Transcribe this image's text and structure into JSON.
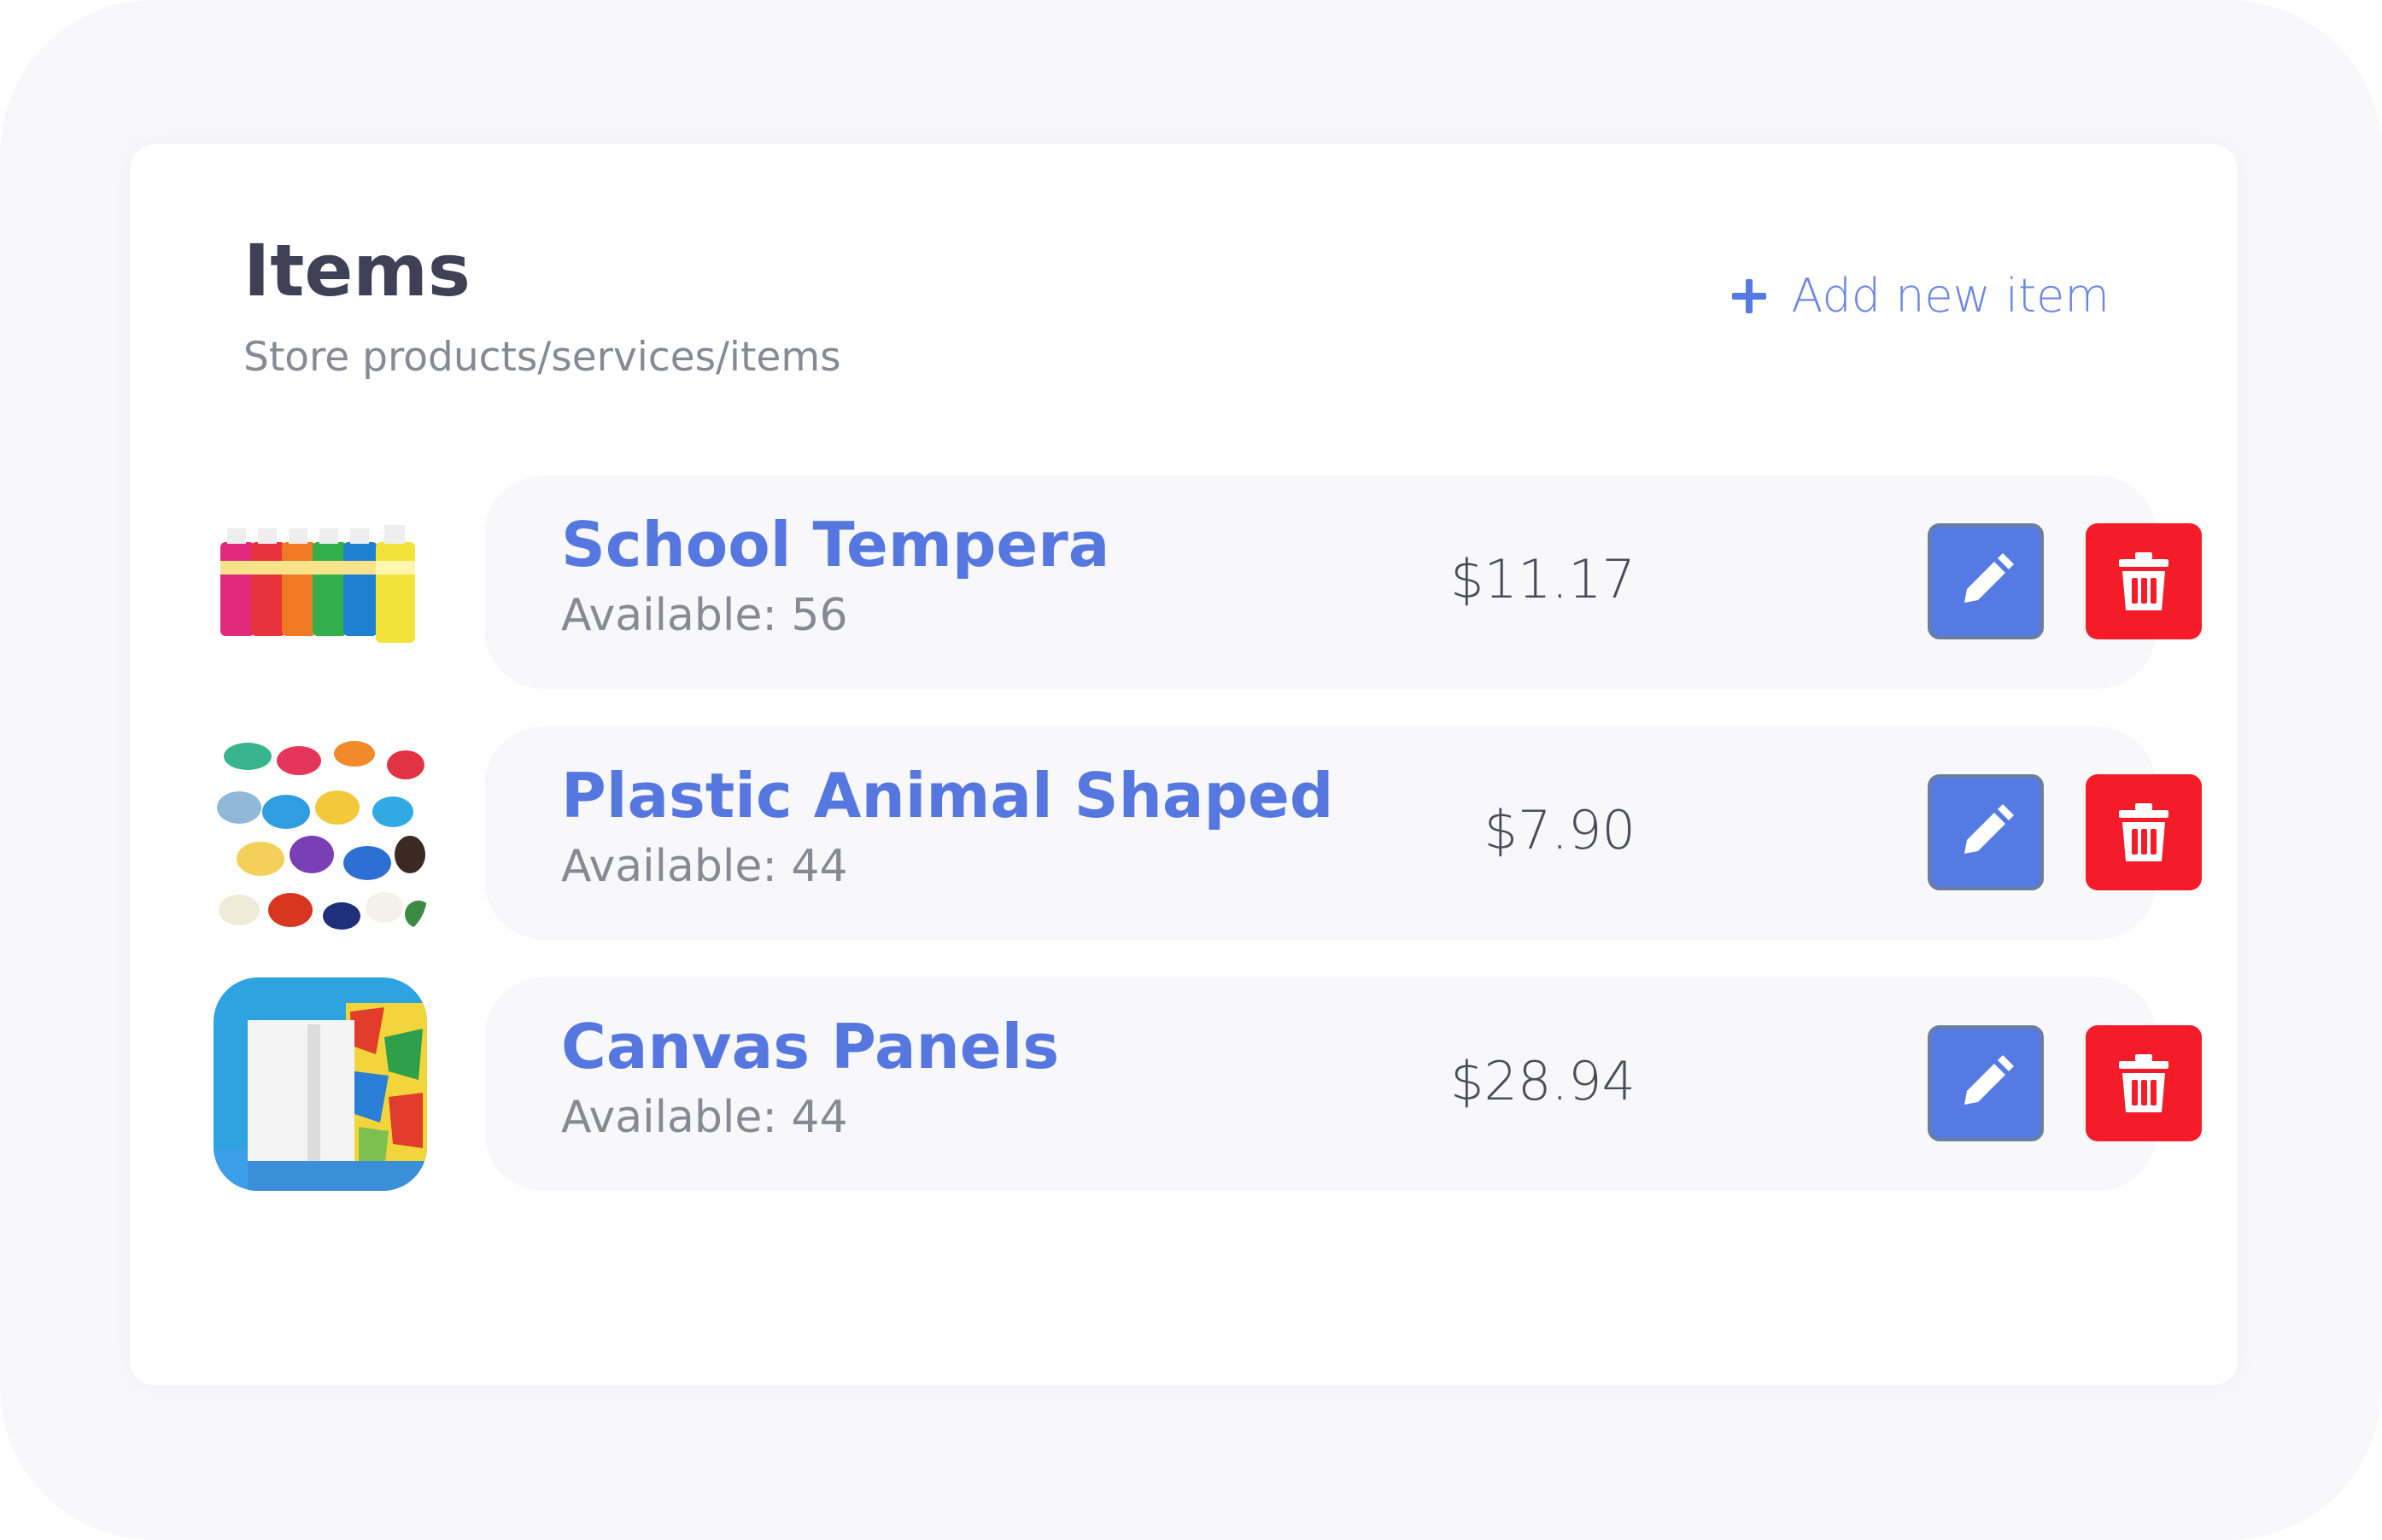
{
  "header": {
    "title": "Items",
    "subtitle": "Store products/services/items",
    "add_label": "Add new item"
  },
  "items": [
    {
      "name": "School Tempera",
      "available": "Available: 56",
      "price": "$11.17",
      "thumbnail_icon": "paint-bottles-image"
    },
    {
      "name": "Plastic Animal Shaped",
      "available": "Available: 44",
      "price": "$7.90",
      "thumbnail_icon": "plastic-animals-image"
    },
    {
      "name": "Canvas Panels",
      "available": "Available: 44",
      "price": "$28.94",
      "thumbnail_icon": "canvas-panels-image"
    }
  ],
  "colors": {
    "accent": "#5577df",
    "edit": "#557ae4",
    "delete": "#f51c2a",
    "panel_bg": "#f8f8fa"
  }
}
